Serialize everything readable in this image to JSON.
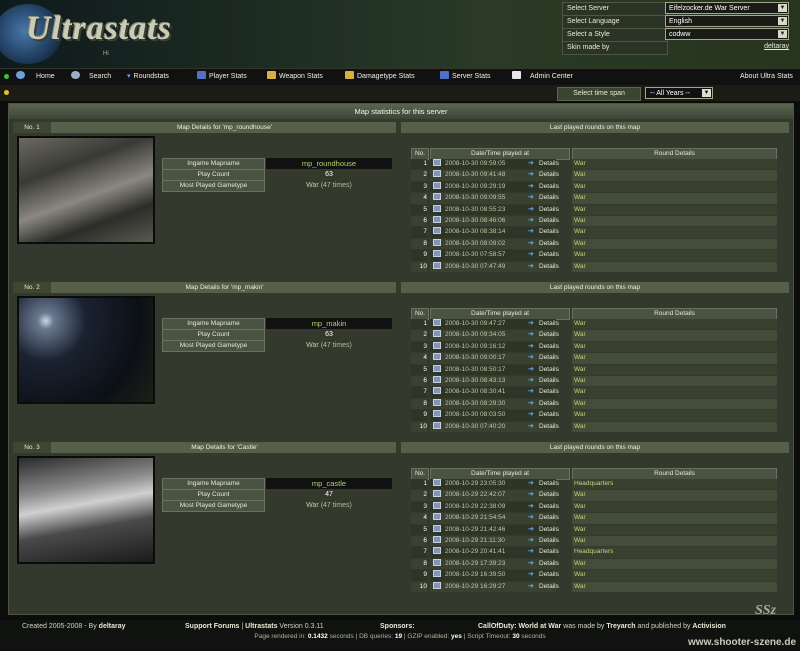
{
  "header": {
    "logo": "Ultrastats",
    "logo_sub": "Hi",
    "select_server_label": "Select Server",
    "select_server_value": "Eifelzocker.de War Server",
    "select_language_label": "Select Language",
    "select_language_value": "English",
    "select_style_label": "Select a Style",
    "select_style_value": "codww",
    "skin_label": "Skin made by",
    "skin_author": "deltaray"
  },
  "nav": {
    "items": [
      "Home",
      "Search",
      "Roundstats",
      "Player Stats",
      "Weapon Stats",
      "Damagetype Stats",
      "Server Stats",
      "Admin Center"
    ],
    "about": "About Ultra Stats"
  },
  "timespan": {
    "label": "Select time span",
    "value": "-- All Years --"
  },
  "main": {
    "title": "Map statistics for this server"
  },
  "labels": {
    "ingame_mapname": "Ingame Mapname",
    "play_count": "Play Count",
    "most_played_gametype": "Most Played Gametype",
    "last_rounds": "Last played rounds on this map",
    "col_no": "No.",
    "col_datetime": "Date/Time played at",
    "col_round": "Round Details",
    "details": "Details"
  },
  "maps": [
    {
      "no": "No. 1",
      "title": "Map Details for 'mp_roundhouse'",
      "mapname": "mp_roundhouse",
      "playcount": "63",
      "gametype": "War",
      "gametype_count": "(47 times)",
      "rounds": [
        {
          "n": "1",
          "dt": "2008-10-30 09:59:05",
          "g": "War"
        },
        {
          "n": "2",
          "dt": "2008-10-30 09:41:48",
          "g": "War"
        },
        {
          "n": "3",
          "dt": "2008-10-30 09:29:19",
          "g": "War"
        },
        {
          "n": "4",
          "dt": "2008-10-30 09:09:55",
          "g": "War"
        },
        {
          "n": "5",
          "dt": "2008-10-30 08:55:23",
          "g": "War"
        },
        {
          "n": "6",
          "dt": "2008-10-30 08:46:06",
          "g": "War"
        },
        {
          "n": "7",
          "dt": "2008-10-30 08:38:14",
          "g": "War"
        },
        {
          "n": "8",
          "dt": "2008-10-30 08:09:02",
          "g": "War"
        },
        {
          "n": "9",
          "dt": "2008-10-30 07:58:57",
          "g": "War"
        },
        {
          "n": "10",
          "dt": "2008-10-30 07:47:49",
          "g": "War"
        }
      ]
    },
    {
      "no": "No. 2",
      "title": "Map Details for 'mp_makin'",
      "mapname": "mp_makin",
      "playcount": "63",
      "gametype": "War",
      "gametype_count": "(47 times)",
      "rounds": [
        {
          "n": "1",
          "dt": "2008-10-30 09:47:27",
          "g": "War"
        },
        {
          "n": "2",
          "dt": "2008-10-30 09:34:05",
          "g": "War"
        },
        {
          "n": "3",
          "dt": "2008-10-30 09:16:12",
          "g": "War"
        },
        {
          "n": "4",
          "dt": "2008-10-30 09:00:17",
          "g": "War"
        },
        {
          "n": "5",
          "dt": "2008-10-30 08:50:17",
          "g": "War"
        },
        {
          "n": "6",
          "dt": "2008-10-30 08:43:13",
          "g": "War"
        },
        {
          "n": "7",
          "dt": "2008-10-30 08:30:41",
          "g": "War"
        },
        {
          "n": "8",
          "dt": "2008-10-30 08:29:30",
          "g": "War"
        },
        {
          "n": "9",
          "dt": "2008-10-30 08:03:50",
          "g": "War"
        },
        {
          "n": "10",
          "dt": "2008-10-30 07:40:20",
          "g": "War"
        }
      ]
    },
    {
      "no": "No. 3",
      "title": "Map Details for 'Castle'",
      "mapname": "mp_castle",
      "playcount": "47",
      "gametype": "War",
      "gametype_count": "(47 times)",
      "rounds": [
        {
          "n": "1",
          "dt": "2008-10-29 23:05:30",
          "g": "Headquarters"
        },
        {
          "n": "2",
          "dt": "2008-10-29 22:42:07",
          "g": "War"
        },
        {
          "n": "3",
          "dt": "2008-10-29 22:38:09",
          "g": "War"
        },
        {
          "n": "4",
          "dt": "2008-10-29 21:54:54",
          "g": "War"
        },
        {
          "n": "5",
          "dt": "2008-10-29 21:42:46",
          "g": "War"
        },
        {
          "n": "6",
          "dt": "2008-10-29 21:11:30",
          "g": "War"
        },
        {
          "n": "7",
          "dt": "2008-10-29 20:41:41",
          "g": "Headquarters"
        },
        {
          "n": "8",
          "dt": "2008-10-29 17:39:23",
          "g": "War"
        },
        {
          "n": "9",
          "dt": "2008-10-29 16:39:50",
          "g": "War"
        },
        {
          "n": "10",
          "dt": "2008-10-29 16:29:27",
          "g": "War"
        }
      ]
    }
  ],
  "footer": {
    "created": "Created 2005-2008 - By",
    "author": "deltaray",
    "support": "Support Forums",
    "ultrastats": "Ultrastats",
    "version": "Version 0.3.11",
    "sponsors": "Sponsors:",
    "game_credit_pre": "CallOfDuty: World at War",
    "game_credit_mid": "was made by",
    "dev": "Treyarch",
    "game_credit_and": "and published by",
    "publisher": "Activision",
    "render_pre": "Page rendered in:",
    "render_time": "0.1432",
    "render_mid": "seconds | DB queries:",
    "queries": "19",
    "gzip_pre": "| GZIP enabled:",
    "gzip": "yes",
    "timeout_pre": "| Script Timeout:",
    "timeout": "30",
    "timeout_post": "seconds",
    "watermark": "www.shooter-szene.de",
    "wm_logo": "SSz"
  },
  "icons": {
    "nav": [
      "home-icon",
      "search-icon",
      "roundstats-icon",
      "player-stats-icon",
      "weapon-stats-icon",
      "damagetype-icon",
      "server-stats-icon",
      "admin-icon"
    ]
  }
}
